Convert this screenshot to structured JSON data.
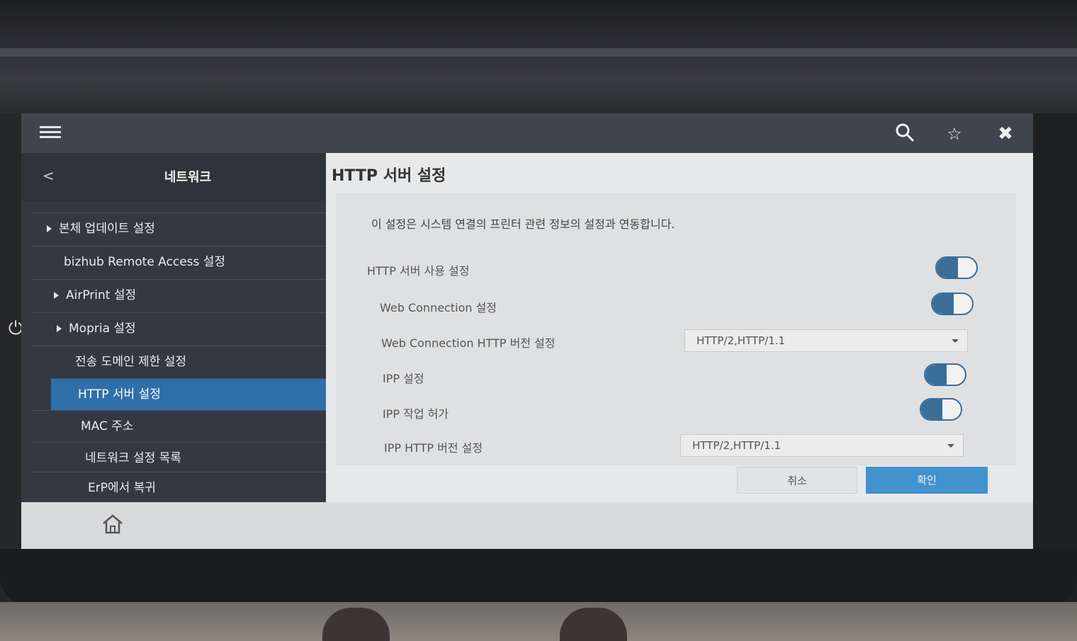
{
  "header": {
    "icons": [
      "menu-icon",
      "search-icon",
      "star-icon",
      "close-icon"
    ]
  },
  "sidebar": {
    "back_glyph": "<",
    "title": "네트워크",
    "items": [
      {
        "label": "본체 업데이트 설정",
        "expandable": true
      },
      {
        "label": "bizhub Remote Access 설정",
        "expandable": false
      },
      {
        "label": "AirPrint 설정",
        "expandable": true
      },
      {
        "label": "Mopria 설정",
        "expandable": true
      },
      {
        "label": "전송 도메인 제한 설정",
        "expandable": false
      },
      {
        "label": "HTTP 서버 설정",
        "expandable": false,
        "active": true
      },
      {
        "label": "MAC 주소",
        "expandable": false
      },
      {
        "label": "네트워크 설정 목록",
        "expandable": false
      },
      {
        "label": "ErP에서 복귀",
        "expandable": false
      }
    ]
  },
  "content": {
    "title": "HTTP 서버 설정",
    "description": "이 설정은 시스템 연결의 프린터 관련 정보의 설정과 연동합니다.",
    "settings": [
      {
        "label": "HTTP 서버 사용 설정",
        "type": "toggle",
        "on": true
      },
      {
        "label": "Web Connection 설정",
        "type": "toggle",
        "on": true
      },
      {
        "label": "Web Connection HTTP 버전 설정",
        "type": "select",
        "value": "HTTP/2,HTTP/1.1"
      },
      {
        "label": "IPP 설정",
        "type": "toggle",
        "on": true
      },
      {
        "label": "IPP 작업 허가",
        "type": "toggle",
        "on": true
      },
      {
        "label": "IPP HTTP 버전 설정",
        "type": "select",
        "value": "HTTP/2,HTTP/1.1"
      }
    ],
    "cancel_label": "취소",
    "ok_label": "확인"
  },
  "colors": {
    "accent": "#2f6fa9",
    "ok_button": "#4292cd",
    "toggle_on": "#3b6d99"
  }
}
